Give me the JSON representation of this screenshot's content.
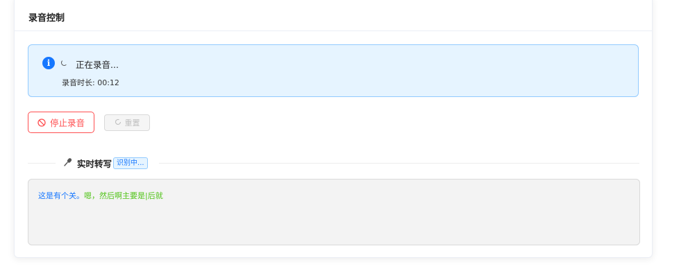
{
  "card": {
    "title": "录音控制"
  },
  "status_alert": {
    "icon": "info-icon",
    "title": "正在录音...",
    "duration_label": "录音时长: 00:12"
  },
  "buttons": {
    "stop_label": "停止录音",
    "stop_icon": "stop-icon",
    "reset_label": "重置",
    "reset_icon": "reload-icon"
  },
  "transcription": {
    "icon": "microphone-icon",
    "title": "实时转写",
    "status_tag": "识别中...",
    "final_text": "这是有个关。",
    "interim_text": "嗯，然后啊主要是|后就"
  },
  "colors": {
    "primary": "#1677ff",
    "danger": "#ff4d4f",
    "interim": "#52c41a",
    "alert_bg": "#e6f4ff"
  }
}
